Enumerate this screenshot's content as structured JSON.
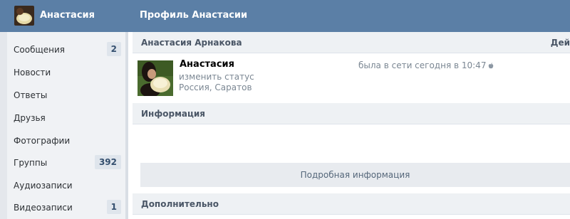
{
  "header": {
    "user_name": "Анастасия",
    "page_title": "Профиль Анастасии"
  },
  "sidebar": {
    "items": [
      {
        "label": "Сообщения",
        "badge": "2"
      },
      {
        "label": "Новости",
        "badge": null
      },
      {
        "label": "Ответы",
        "badge": null
      },
      {
        "label": "Друзья",
        "badge": null
      },
      {
        "label": "Фотографии",
        "badge": null
      },
      {
        "label": "Группы",
        "badge": "392"
      },
      {
        "label": "Аудиозаписи",
        "badge": null
      },
      {
        "label": "Видеозаписи",
        "badge": "1"
      }
    ]
  },
  "profile": {
    "section_title": "Анастасия Арнакова",
    "section_right": "Дей",
    "name": "Анастасия",
    "status_link": "изменить статус",
    "location": "Россия, Саратов",
    "online_text": "была в сети сегодня в 10:47",
    "online_icon": "apple-icon"
  },
  "info": {
    "section_title": "Информация",
    "details_button": "Подробная информация"
  },
  "extra": {
    "section_title": "Дополнительно"
  },
  "colors": {
    "header_bg": "#5b7fa6",
    "sidebar_bg": "#f0f2f5",
    "badge_bg": "#dfe5ec"
  }
}
